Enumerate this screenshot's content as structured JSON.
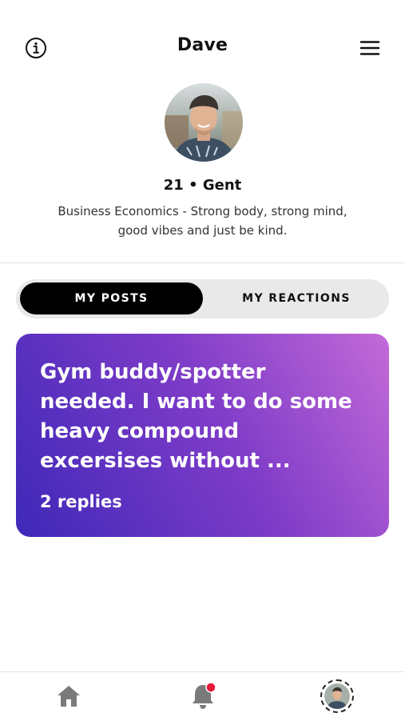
{
  "header": {
    "title": "Dave"
  },
  "profile": {
    "age_city": "21 • Gent",
    "bio": "Business Economics - Strong body, strong mind, good vibes and just be kind."
  },
  "tabs": [
    {
      "label": "MY POSTS",
      "active": true
    },
    {
      "label": "MY REACTIONS",
      "active": false
    }
  ],
  "posts": [
    {
      "text": "Gym buddy/spotter needed. I want to do some heavy compound excersises without ...",
      "replies": "2 replies"
    }
  ],
  "nav": {
    "items": [
      "home-icon",
      "bell-icon",
      "profile-avatar"
    ],
    "notification_dot_color": "#e8173a"
  },
  "colors": {
    "card_gradient_start": "#3e28b8",
    "card_gradient_end": "#c36ad8",
    "active_tab_bg": "#000000",
    "segmented_bg": "#e9e9e9"
  }
}
